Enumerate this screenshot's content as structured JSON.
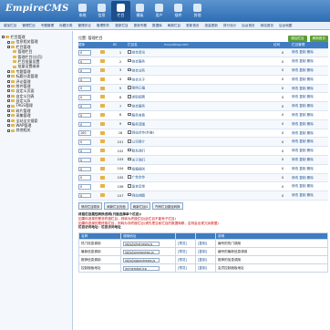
{
  "app": {
    "logo": "EmpireCMS"
  },
  "nav": [
    {
      "label": "系统",
      "active": false
    },
    {
      "label": "信息",
      "active": false
    },
    {
      "label": "栏目",
      "active": true
    },
    {
      "label": "模板",
      "active": false
    },
    {
      "label": "用户",
      "active": false
    },
    {
      "label": "插件",
      "active": false
    },
    {
      "label": "其他",
      "active": false
    }
  ],
  "subnav": [
    "增加栏目",
    "管理栏目",
    "专题管理",
    "标题分类",
    "管理评论",
    "管理附件",
    "更新栏目",
    "更新专题",
    "数据库",
    "刷新栏目",
    "更新首页",
    "批量更新",
    "排行设计",
    "后台首页",
    "网站首页",
    "后台地图"
  ],
  "sidebar": [
    {
      "label": "栏目管理",
      "level": 1
    },
    {
      "label": "信息相关管理",
      "level": 2
    },
    {
      "label": "栏目管理",
      "level": 2
    },
    {
      "label": "管理栏目",
      "level": 3
    },
    {
      "label": "管理栏目(分页)",
      "level": 3
    },
    {
      "label": "栏目批量设置",
      "level": 3
    },
    {
      "label": "批量设置继承",
      "level": 3
    },
    {
      "label": "专题管理",
      "level": 2
    },
    {
      "label": "标题分类管理",
      "level": 2
    },
    {
      "label": "评论管理",
      "level": 2
    },
    {
      "label": "附件管理",
      "level": 2
    },
    {
      "label": "自定义页面",
      "level": 2
    },
    {
      "label": "自定义列表",
      "level": 2
    },
    {
      "label": "自定义JS",
      "level": 2
    },
    {
      "label": "TAGS管理",
      "level": 2
    },
    {
      "label": "碎片管理",
      "level": 2
    },
    {
      "label": "采集管理",
      "level": 2
    },
    {
      "label": "全站全文搜索",
      "level": 2
    },
    {
      "label": "WAP管理",
      "level": 2
    },
    {
      "label": "其他相关",
      "level": 2
    }
  ],
  "main": {
    "location": "位置: 管理栏目",
    "buttons": [
      "增加栏目",
      "刷新首页"
    ],
    "columns": [
      "顺序",
      "",
      "ID",
      "栏目名",
      "",
      "访问",
      "栏目管理"
    ],
    "watermark": "moyublog.com",
    "rows": [
      {
        "order": "0",
        "id": "1",
        "name": "综合资讯",
        "visits": "0"
      },
      {
        "order": "0",
        "id": "2",
        "name": "综合服务",
        "visits": "0"
      },
      {
        "order": "0",
        "id": "3",
        "name": "综合业务",
        "visits": "0"
      },
      {
        "order": "0",
        "id": "4",
        "name": "综合点子",
        "visits": "0"
      },
      {
        "order": "0",
        "id": "5",
        "name": "案例汇编",
        "visits": "0"
      },
      {
        "order": "0",
        "id": "6",
        "name": "求职招聘",
        "visits": "0"
      },
      {
        "order": "0",
        "id": "7",
        "name": "综合服务",
        "visits": "0"
      },
      {
        "order": "0",
        "id": "8",
        "name": "服务收费",
        "visits": "0"
      },
      {
        "order": "0",
        "id": "9",
        "name": "服务范围",
        "visits": "0"
      },
      {
        "order": "100",
        "id": "18",
        "name": "网站合作(外链)",
        "visits": "0"
      },
      {
        "order": "0",
        "id": "101",
        "name": "公司简介",
        "visits": "0"
      },
      {
        "order": "0",
        "id": "102",
        "name": "联系我们",
        "visits": "0"
      },
      {
        "order": "0",
        "id": "103",
        "name": "关于我们",
        "visits": "0"
      },
      {
        "order": "0",
        "id": "104",
        "name": "投稿规则",
        "visits": "0"
      },
      {
        "order": "0",
        "id": "105",
        "name": "广告合作",
        "visits": "0"
      },
      {
        "order": "0",
        "id": "106",
        "name": "留言反馈",
        "visits": "0"
      },
      {
        "order": "0",
        "id": "107",
        "name": "网站地图",
        "visits": "0"
      }
    ],
    "actions": [
      "修改栏目顺序",
      "刷新栏目页面",
      "刷新栏目JS",
      "所有栏目路径转换"
    ],
    "note_title": "终极栏目属性转换说明(只能选择单个栏目):",
    "note_1": "如果你选择的是非终极栏目，则转为终极栏目(此栏目不能有子栏目)",
    "note_2": "如果你选择的是终极栏目，则转为非终极栏目(请先把当前栏目的数据转移，否则会出现冗余数据)",
    "note_3": "栏目访问地址：栏目访问地址",
    "table2_headers": [
      "名称",
      "调用地址",
      "",
      "",
      "说明"
    ],
    "table2_rows": [
      {
        "name": "热门信息调用",
        "addr": "/d/js/js/hotnews.js",
        "a": "[预览]",
        "b": "[复制]",
        "desc": "编号的热门调用"
      },
      {
        "name": "最新信息调用",
        "addr": "/d/js/js/newnews.js",
        "a": "[预览]",
        "b": "[复制]",
        "desc": "编号的最新信息调用"
      },
      {
        "name": "推荐信息调用",
        "addr": "/d/js/js/goodnews.js",
        "a": "[预览]",
        "b": "[复制]",
        "desc": "推荐的信息调用"
      },
      {
        "name": "控制面板地址",
        "addr": "/e/member/cp",
        "a": "[预览]",
        "b": "[复制]",
        "desc": "会员控制面板地址"
      }
    ]
  }
}
